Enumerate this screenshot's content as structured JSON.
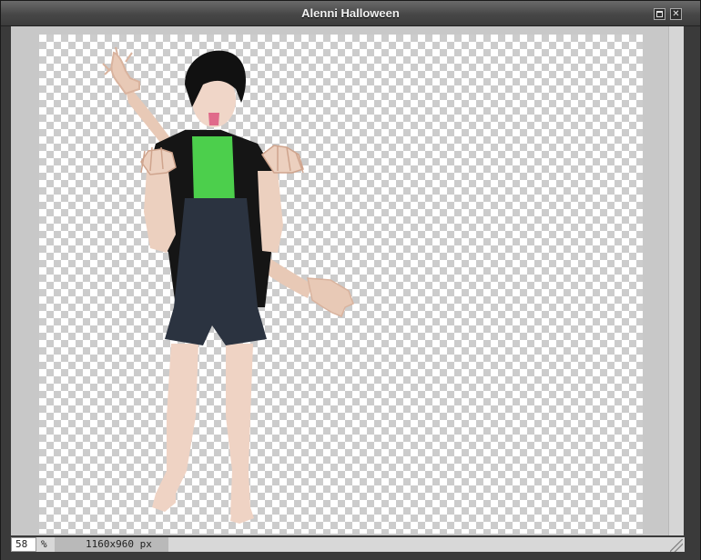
{
  "window": {
    "title": "Alenni Halloween",
    "maximize_icon": "maximize-icon",
    "close_icon": "close-icon",
    "close_glyph": "✕"
  },
  "canvas": {
    "background": "transparency-checkerboard"
  },
  "status": {
    "zoom_value": "58",
    "zoom_unit": "%",
    "dimensions": "1160x960 px"
  }
}
